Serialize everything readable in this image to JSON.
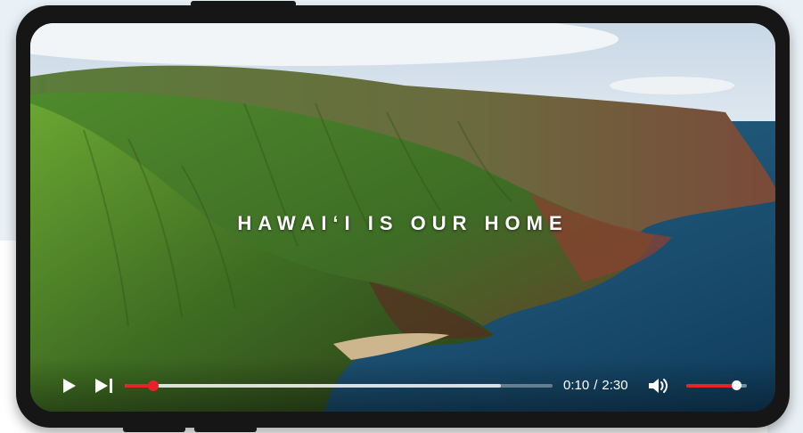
{
  "video": {
    "title_overlay": "HAWAI‘I IS OUR HOME",
    "current_time": "0:10",
    "separator": "/",
    "duration": "2:30",
    "progress_fraction": 0.067,
    "buffered_fraction": 0.88,
    "volume_fraction": 0.82
  },
  "controls": {
    "play_icon": "play-icon",
    "next_icon": "skip-next-icon",
    "volume_icon": "volume-icon"
  },
  "colors": {
    "accent": "#e8222a",
    "frame": "#161616",
    "backdrop": "#e9f1f6"
  }
}
